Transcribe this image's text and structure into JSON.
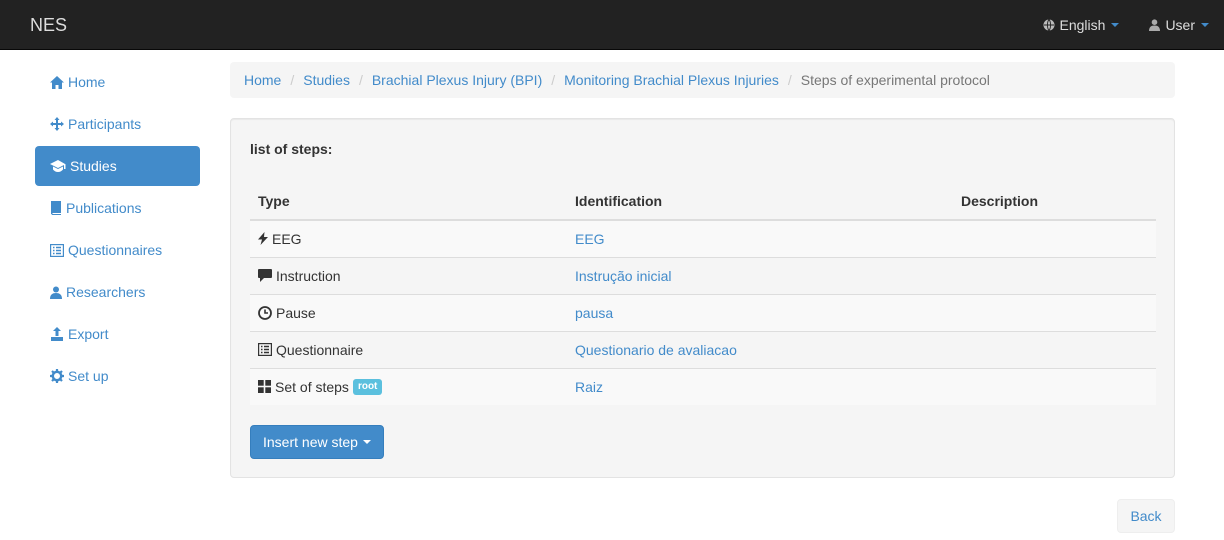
{
  "navbar": {
    "brand": "NES",
    "language": "English",
    "user": "User",
    "accent_color": "#428bca"
  },
  "sidebar": {
    "items": [
      {
        "label": "Home",
        "icon": "home-icon"
      },
      {
        "label": "Participants",
        "icon": "move-icon"
      },
      {
        "label": "Studies",
        "icon": "education-icon",
        "active": true
      },
      {
        "label": "Publications",
        "icon": "book-icon"
      },
      {
        "label": "Questionnaires",
        "icon": "list-alt-icon"
      },
      {
        "label": "Researchers",
        "icon": "user-icon"
      },
      {
        "label": "Export",
        "icon": "export-icon"
      },
      {
        "label": "Set up",
        "icon": "cog-icon"
      }
    ]
  },
  "breadcrumb": [
    "Home",
    "Studies",
    "Brachial Plexus Injury (BPI)",
    "Monitoring Brachial Plexus Injuries",
    "Steps of experimental protocol"
  ],
  "panel": {
    "title": "list of steps:",
    "columns": [
      "Type",
      "Identification",
      "Description"
    ],
    "rows": [
      {
        "type": "EEG",
        "icon": "flash-icon",
        "identification": "EEG",
        "description": ""
      },
      {
        "type": "Instruction",
        "icon": "comment-icon",
        "identification": "Instrução inicial",
        "description": ""
      },
      {
        "type": "Pause",
        "icon": "time-icon",
        "identification": "pausa",
        "description": ""
      },
      {
        "type": "Questionnaire",
        "icon": "list-alt-icon",
        "identification": "Questionario de avaliacao",
        "description": ""
      },
      {
        "type": "Set of steps",
        "icon": "th-large-icon",
        "badge": "root",
        "identification": "Raiz",
        "description": ""
      }
    ],
    "insert_button": "Insert new step"
  },
  "back_button": "Back"
}
